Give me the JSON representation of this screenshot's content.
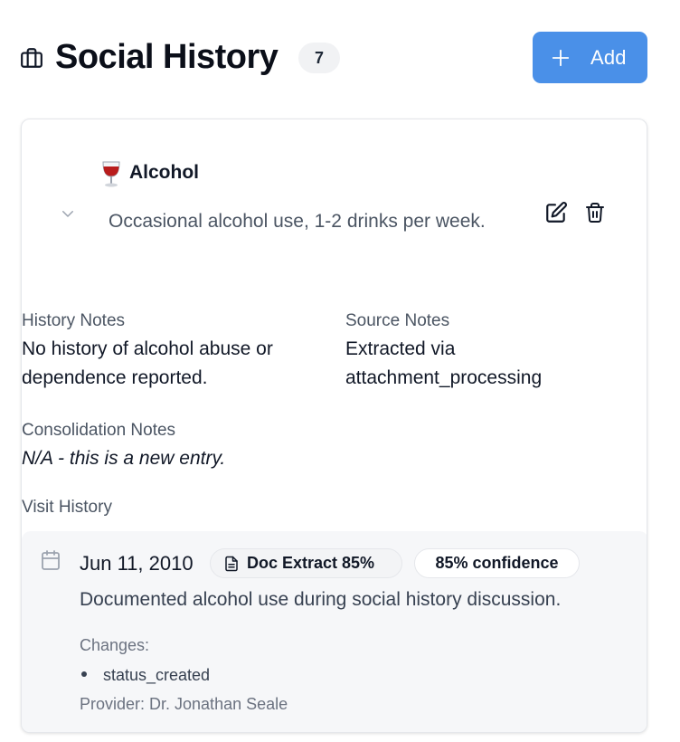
{
  "header": {
    "title": "Social History",
    "count": "7",
    "add_label": "Add"
  },
  "entry": {
    "emoji": "🍷",
    "title": "Alcohol",
    "description": "Occasional alcohol use, 1-2 drinks per week.",
    "history_notes_label": "History Notes",
    "history_notes_value": "No history of alcohol abuse or dependence reported.",
    "source_notes_label": "Source Notes",
    "source_notes_value": "Extracted via attachment_processing",
    "consolidation_notes_label": "Consolidation Notes",
    "consolidation_notes_value": "N/A - this is a new entry.",
    "visit_history_label": "Visit History"
  },
  "visit": {
    "date": "Jun 11, 2010",
    "doc_badge": "Doc Extract 85%",
    "confidence_badge": "85% confidence",
    "description": "Documented alcohol use during social history discussion.",
    "changes_label": "Changes:",
    "changes": [
      "status_created"
    ],
    "provider": "Provider: Dr. Jonathan Seale"
  },
  "colors": {
    "accent": "#4a90e8",
    "visit_background": "#f6f7f9"
  },
  "icons": [
    "briefcase-icon",
    "plus-icon",
    "chevron-down-icon",
    "wine-glass-icon",
    "edit-icon",
    "trash-icon",
    "calendar-icon",
    "document-icon"
  ]
}
